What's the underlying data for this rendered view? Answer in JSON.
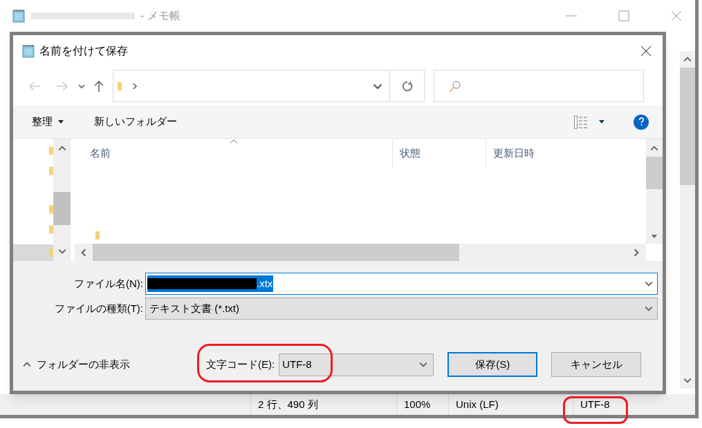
{
  "notepad": {
    "title": "- メモ帳",
    "title_redacted": true,
    "status_bar": [
      "2 行、490 列",
      "100%",
      "Unix (LF)",
      "UTF-8"
    ]
  },
  "dialog": {
    "title": "名前を付けて保存",
    "toolbar": {
      "organize": "整理",
      "new_folder": "新しいフォルダー"
    },
    "columns": [
      {
        "label": "名前",
        "sorted": true
      },
      {
        "label": "状態",
        "sorted": false
      },
      {
        "label": "更新日時",
        "sorted": false
      }
    ],
    "file_name": {
      "label": "ファイル名(N):",
      "value": ".xtx",
      "redacted": true
    },
    "file_type": {
      "label": "ファイルの種類(T):",
      "value": "テキスト文書 (*.txt)"
    },
    "hide_folders": "フォルダーの非表示",
    "encoding": {
      "label": "文字コード(E):",
      "value": "UTF-8"
    },
    "buttons": [
      {
        "label": "保存(S)",
        "default": true
      },
      {
        "label": "キャンセル",
        "default": false
      }
    ]
  }
}
